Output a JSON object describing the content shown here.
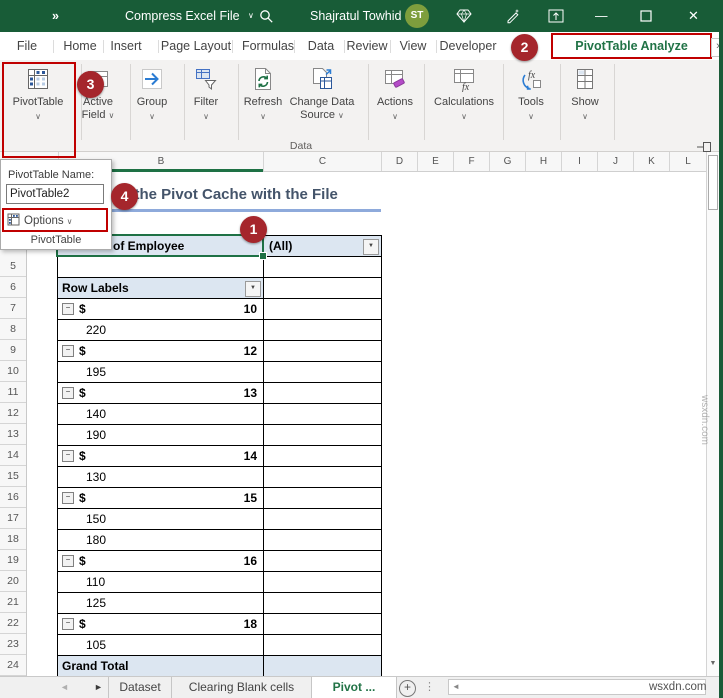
{
  "titlebar": {
    "quick_access": "»",
    "doc_title": "Compress Excel File",
    "user_name": "Shajratul Towhid",
    "avatar_initials": "ST"
  },
  "menubar": {
    "tabs": [
      "File",
      "Home",
      "Insert",
      "Page Layout",
      "Formulas",
      "Data",
      "Review",
      "View",
      "Developer"
    ],
    "active_tab": "PivotTable Analyze",
    "more_tabs": "›"
  },
  "ribbon": {
    "buttons": [
      {
        "id": "pivottable",
        "label": "PivotTable"
      },
      {
        "id": "active-field",
        "label": "Active Field"
      },
      {
        "id": "group",
        "label": "Group"
      },
      {
        "id": "filter",
        "label": "Filter"
      },
      {
        "id": "refresh",
        "label": "Refresh"
      },
      {
        "id": "change-data-source",
        "label": "Change Data Source"
      },
      {
        "id": "actions",
        "label": "Actions"
      },
      {
        "id": "calculations",
        "label": "Calculations"
      },
      {
        "id": "tools",
        "label": "Tools"
      },
      {
        "id": "show",
        "label": "Show"
      }
    ],
    "group_label": "Data"
  },
  "popup": {
    "title": "PivotTable Name:",
    "input_value": "PivotTable2",
    "options_label": "Options",
    "group_label": "PivotTable"
  },
  "annotations": {
    "circles": [
      "1",
      "2",
      "3",
      "4"
    ],
    "circle_color": "#A5262C",
    "box_color": "#C00000"
  },
  "sheet": {
    "heading": "ng the Pivot Cache with the File",
    "heading_color": "#44546A",
    "heading_underline_color": "#8EAADB",
    "col_headers": [
      "B",
      "C",
      "D",
      "E",
      "F",
      "G",
      "H",
      "I",
      "J",
      "K",
      "L"
    ],
    "row_numbers": [
      5,
      6,
      7,
      8,
      9,
      10,
      11,
      12,
      13,
      14,
      15,
      16,
      17,
      18,
      19,
      20,
      21,
      22,
      23,
      24
    ],
    "selection_color": "#1E7145",
    "pivot": {
      "header_fill": "#DCE6F1",
      "rows": [
        {
          "n": 4,
          "type": "filter",
          "label": "of Employee",
          "value": "(All)"
        },
        {
          "n": 5,
          "type": "empty"
        },
        {
          "n": 6,
          "type": "colheader",
          "label": "Row Labels"
        },
        {
          "n": 7,
          "type": "group",
          "currency": "$",
          "value": "10"
        },
        {
          "n": 8,
          "type": "item",
          "value": "220"
        },
        {
          "n": 9,
          "type": "group",
          "currency": "$",
          "value": "12"
        },
        {
          "n": 10,
          "type": "item",
          "value": "195"
        },
        {
          "n": 11,
          "type": "group",
          "currency": "$",
          "value": "13"
        },
        {
          "n": 12,
          "type": "item",
          "value": "140"
        },
        {
          "n": 13,
          "type": "item",
          "value": "190"
        },
        {
          "n": 14,
          "type": "group",
          "currency": "$",
          "value": "14"
        },
        {
          "n": 15,
          "type": "item",
          "value": "130"
        },
        {
          "n": 16,
          "type": "group",
          "currency": "$",
          "value": "15"
        },
        {
          "n": 17,
          "type": "item",
          "value": "150"
        },
        {
          "n": 18,
          "type": "item",
          "value": "180"
        },
        {
          "n": 19,
          "type": "group",
          "currency": "$",
          "value": "16"
        },
        {
          "n": 20,
          "type": "item",
          "value": "110"
        },
        {
          "n": 21,
          "type": "item",
          "value": "125"
        },
        {
          "n": 22,
          "type": "group",
          "currency": "$",
          "value": "18"
        },
        {
          "n": 23,
          "type": "item",
          "value": "105"
        },
        {
          "n": 24,
          "type": "total",
          "label": "Grand Total"
        }
      ]
    }
  },
  "tabbar": {
    "sheets": [
      {
        "label": "Dataset",
        "active": false
      },
      {
        "label": "Clearing Blank cells",
        "active": false
      },
      {
        "label": "Pivot",
        "active": true,
        "suffix": " ..."
      }
    ]
  },
  "icons": {
    "dropdown_arrow": "▼",
    "collapse_minus": "−",
    "chevron_down": "∨",
    "minimize": "—",
    "close": "✕",
    "prev_sheet": "◄",
    "next_sheet": "►",
    "add_sheet": "+",
    "vertical_dots": "⋮",
    "scroll_left": "◄",
    "scroll_down": "▼"
  },
  "colors": {
    "titlebar_green": "#185C37",
    "accent_green": "#217346",
    "annotation_red": "#A5262C",
    "box_red": "#C00000",
    "pivot_header_fill": "#DCE6F1"
  },
  "watermark": "wsxdn.com"
}
